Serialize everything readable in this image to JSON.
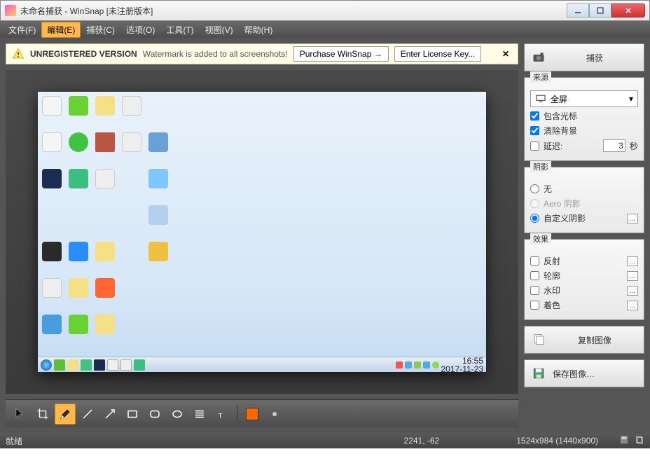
{
  "window": {
    "title": "未命名捕获 - WinSnap  [未注册版本]"
  },
  "menu": {
    "file": "文件(F)",
    "edit": "编辑(E)",
    "capture": "捕获(C)",
    "options": "选项(O)",
    "tools": "工具(T)",
    "view": "视图(V)",
    "help": "帮助(H)"
  },
  "unregistered": {
    "title": "UNREGISTERED VERSION",
    "message": "Watermark is added to all screenshots!",
    "purchase_btn": "Purchase WinSnap →",
    "license_btn": "Enter License Key...",
    "close": "✕"
  },
  "preview": {
    "clock_time": "16:55",
    "clock_date": "2017-11-23"
  },
  "toolbar": {
    "color": "#ff6600"
  },
  "statusbar": {
    "ready": "就绪",
    "coords": "2241, -62",
    "dimensions": "1524x984 (1440x900)"
  },
  "panel": {
    "capture_btn": "捕获",
    "source": {
      "title": "来源",
      "mode": "全屏",
      "include_cursor": "包含光标",
      "clear_bg": "清除背景",
      "delay_label": "延迟:",
      "delay_value": "3",
      "delay_unit": "秒"
    },
    "shadow": {
      "title": "阴影",
      "none": "无",
      "aero": "Aero 阴影",
      "custom": "自定义阴影"
    },
    "effects": {
      "title": "效果",
      "reflection": "反射",
      "contour": "轮廓",
      "watermark": "水印",
      "colorize": "着色"
    },
    "copy_btn": "复制图像",
    "save_btn": "保存图像…"
  }
}
